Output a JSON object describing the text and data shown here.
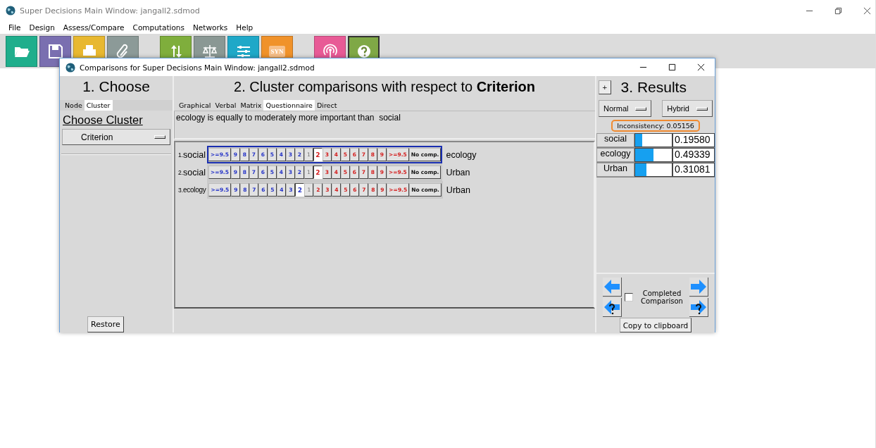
{
  "main_window": {
    "title": "Super Decisions Main Window: jangall2.sdmod"
  },
  "menu": [
    "File",
    "Design",
    "Assess/Compare",
    "Computations",
    "Networks",
    "Help"
  ],
  "toolbar": [
    [
      {
        "color": "#1fae8c"
      },
      {
        "color": "#7a6fb0"
      },
      {
        "color": "#e8b830"
      },
      {
        "color": "#8c9a98"
      }
    ],
    [
      {
        "color": "#7fae3c"
      },
      {
        "color": "#8a9894"
      },
      {
        "color": "#1fa8c8"
      },
      {
        "color": "#f0922a",
        "label": "SYN"
      }
    ],
    [
      {
        "color": "#e85a96"
      },
      {
        "color": "#7fa846",
        "selected": true
      }
    ]
  ],
  "dialog": {
    "title": "Comparisons for Super Decisions Main Window: jangall2.sdmod",
    "choose": {
      "heading": "1. Choose",
      "tabs": [
        {
          "label": "Node",
          "selected": false
        },
        {
          "label": "Cluster",
          "selected": true
        }
      ],
      "subheading": "Choose Cluster",
      "dropdown": "Criterion",
      "restore": "Restore"
    },
    "compare": {
      "heading": "2. Cluster comparisons with respect to **Criterion**",
      "tabs": [
        {
          "label": "Graphical",
          "selected": false
        },
        {
          "label": "Verbal",
          "selected": false
        },
        {
          "label": "Matrix",
          "selected": false
        },
        {
          "label": "Questionnaire",
          "selected": true
        },
        {
          "label": "Direct",
          "selected": false
        }
      ],
      "statement": "ecology is equally to moderately more important than  social",
      "rows": [
        {
          "number": "1.",
          "left": "social",
          "right": "ecology",
          "active": true,
          "cells": [
            {
              "label": ">=9.5",
              "kind": "left",
              "selected": false
            },
            {
              "label": "9",
              "kind": "left",
              "selected": false
            },
            {
              "label": "8",
              "kind": "left",
              "selected": false
            },
            {
              "label": "7",
              "kind": "left",
              "selected": false
            },
            {
              "label": "6",
              "kind": "left",
              "selected": false
            },
            {
              "label": "5",
              "kind": "left",
              "selected": false
            },
            {
              "label": "4",
              "kind": "left",
              "selected": false
            },
            {
              "label": "3",
              "kind": "left",
              "selected": false
            },
            {
              "label": "2",
              "kind": "left",
              "selected": false
            },
            {
              "label": "1",
              "kind": "equal",
              "selected": false
            },
            {
              "label": "2",
              "kind": "right",
              "selected": true
            },
            {
              "label": "3",
              "kind": "right",
              "selected": false
            },
            {
              "label": "4",
              "kind": "right",
              "selected": false
            },
            {
              "label": "5",
              "kind": "right",
              "selected": false
            },
            {
              "label": "6",
              "kind": "right",
              "selected": false
            },
            {
              "label": "7",
              "kind": "right",
              "selected": false
            },
            {
              "label": "8",
              "kind": "right",
              "selected": false
            },
            {
              "label": "9",
              "kind": "right",
              "selected": false
            },
            {
              "label": ">=9.5",
              "kind": "right",
              "selected": false
            },
            {
              "label": "No comp.",
              "kind": "none",
              "selected": false
            }
          ]
        },
        {
          "number": "2.",
          "left": "social",
          "right": "Urban",
          "active": false,
          "cells": [
            {
              "label": ">=9.5",
              "kind": "left",
              "selected": false
            },
            {
              "label": "9",
              "kind": "left",
              "selected": false
            },
            {
              "label": "8",
              "kind": "left",
              "selected": false
            },
            {
              "label": "7",
              "kind": "left",
              "selected": false
            },
            {
              "label": "6",
              "kind": "left",
              "selected": false
            },
            {
              "label": "5",
              "kind": "left",
              "selected": false
            },
            {
              "label": "4",
              "kind": "left",
              "selected": false
            },
            {
              "label": "3",
              "kind": "left",
              "selected": false
            },
            {
              "label": "2",
              "kind": "left",
              "selected": false
            },
            {
              "label": "1",
              "kind": "equal",
              "selected": false
            },
            {
              "label": "2",
              "kind": "right",
              "selected": true
            },
            {
              "label": "3",
              "kind": "right",
              "selected": false
            },
            {
              "label": "4",
              "kind": "right",
              "selected": false
            },
            {
              "label": "5",
              "kind": "right",
              "selected": false
            },
            {
              "label": "6",
              "kind": "right",
              "selected": false
            },
            {
              "label": "7",
              "kind": "right",
              "selected": false
            },
            {
              "label": "8",
              "kind": "right",
              "selected": false
            },
            {
              "label": "9",
              "kind": "right",
              "selected": false
            },
            {
              "label": ">=9.5",
              "kind": "right",
              "selected": false
            },
            {
              "label": "No comp.",
              "kind": "none",
              "selected": false
            }
          ]
        },
        {
          "number": "3.",
          "left": "ecology",
          "right": "Urban",
          "active": false,
          "cells": [
            {
              "label": ">=9.5",
              "kind": "left",
              "selected": false
            },
            {
              "label": "9",
              "kind": "left",
              "selected": false
            },
            {
              "label": "8",
              "kind": "left",
              "selected": false
            },
            {
              "label": "7",
              "kind": "left",
              "selected": false
            },
            {
              "label": "6",
              "kind": "left",
              "selected": false
            },
            {
              "label": "5",
              "kind": "left",
              "selected": false
            },
            {
              "label": "4",
              "kind": "left",
              "selected": false
            },
            {
              "label": "3",
              "kind": "left",
              "selected": false
            },
            {
              "label": "2",
              "kind": "left",
              "selected": true
            },
            {
              "label": "1",
              "kind": "equal",
              "selected": false
            },
            {
              "label": "2",
              "kind": "right",
              "selected": false
            },
            {
              "label": "3",
              "kind": "right",
              "selected": false
            },
            {
              "label": "4",
              "kind": "right",
              "selected": false
            },
            {
              "label": "5",
              "kind": "right",
              "selected": false
            },
            {
              "label": "6",
              "kind": "right",
              "selected": false
            },
            {
              "label": "7",
              "kind": "right",
              "selected": false
            },
            {
              "label": "8",
              "kind": "right",
              "selected": false
            },
            {
              "label": "9",
              "kind": "right",
              "selected": false
            },
            {
              "label": ">=9.5",
              "kind": "right",
              "selected": false
            },
            {
              "label": "No comp.",
              "kind": "none",
              "selected": false
            }
          ]
        }
      ]
    },
    "results": {
      "plus": "+",
      "heading": "3. Results",
      "modes": [
        "Normal",
        "Hybrid"
      ],
      "inconsistency": "Inconsistency: 0.05156",
      "rows": [
        {
          "name": "social",
          "level": 0.1958,
          "value": "0.19580"
        },
        {
          "name": "ecology",
          "level": 0.49339,
          "value": "0.49339"
        },
        {
          "name": "Urban",
          "level": 0.31081,
          "value": "0.31081"
        }
      ],
      "completed": {
        "label": "Completed Comparison",
        "checked": false
      },
      "copy": "Copy to clipboard"
    }
  }
}
